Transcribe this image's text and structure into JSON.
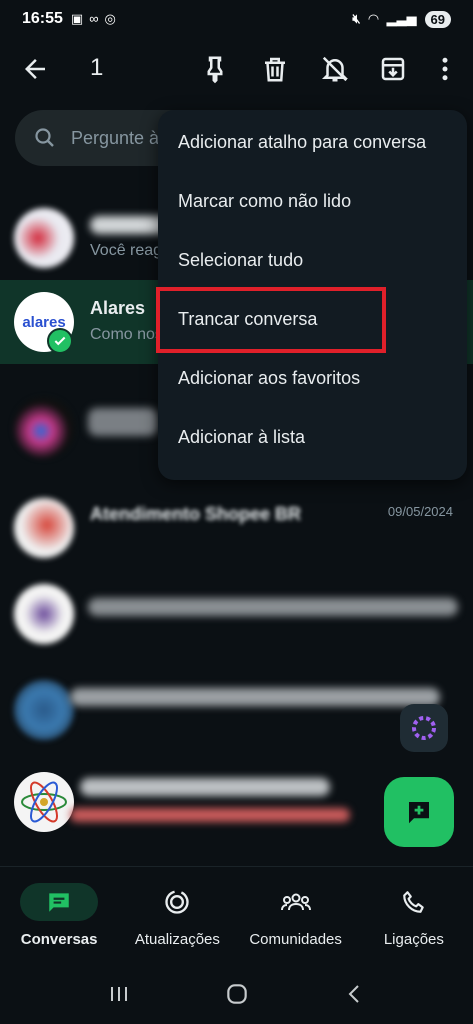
{
  "status": {
    "time": "16:55",
    "battery": "69"
  },
  "appbar": {
    "selected_count": "1"
  },
  "search": {
    "placeholder": "Pergunte à Meta AI ou pesquise"
  },
  "chats": [
    {
      "name": "",
      "preview": "Você reagiu",
      "date": ""
    },
    {
      "name": "Alares",
      "preview": "Como nos avaliar",
      "date": "",
      "avatar_text": "alares"
    },
    {
      "name": "",
      "preview": "",
      "date": ""
    },
    {
      "name": "Atendimento Shopee BR",
      "preview": "",
      "date": "09/05/2024"
    },
    {
      "name": "",
      "preview": "",
      "date": ""
    },
    {
      "name": "",
      "preview": "",
      "date": ""
    },
    {
      "name": "",
      "preview": "",
      "date": ""
    }
  ],
  "menu": {
    "items": [
      "Adicionar atalho para conversa",
      "Marcar como não lido",
      "Selecionar tudo",
      "Trancar conversa",
      "Adicionar aos favoritos",
      "Adicionar à lista"
    ]
  },
  "nav": [
    {
      "label": "Conversas",
      "icon": "chat-icon",
      "active": true
    },
    {
      "label": "Atualizações",
      "icon": "updates-icon",
      "active": false
    },
    {
      "label": "Comunidades",
      "icon": "communities-icon",
      "active": false
    },
    {
      "label": "Ligações",
      "icon": "phone-icon",
      "active": false
    }
  ],
  "colors": {
    "background": "#0b1014",
    "accent": "#21c063",
    "selected_row": "#103529",
    "highlight_box": "#e0202a"
  }
}
